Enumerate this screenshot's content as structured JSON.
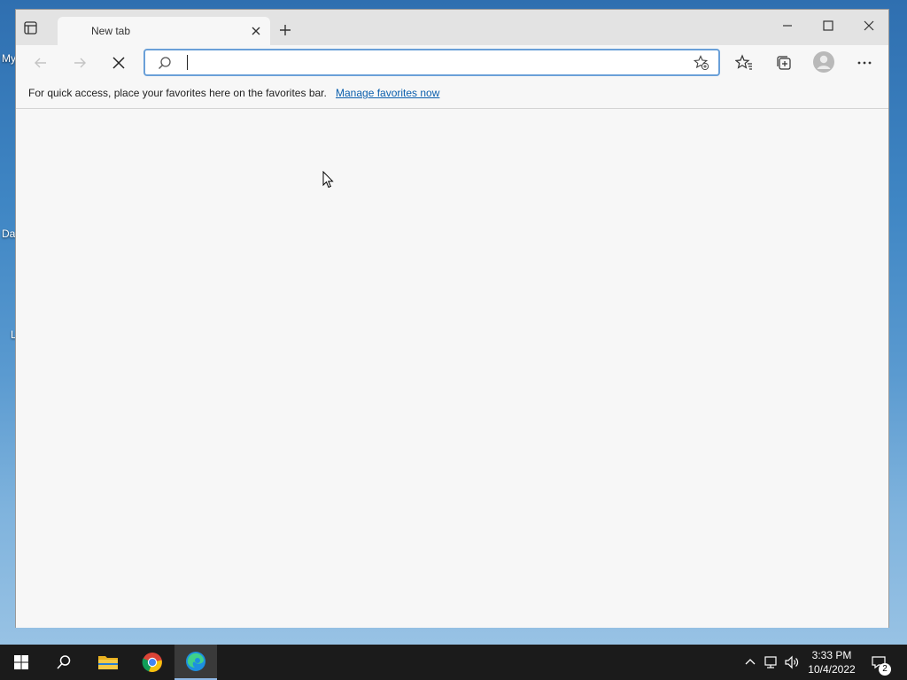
{
  "desktop": {
    "labels": [
      "My",
      "Da",
      "L"
    ]
  },
  "browser": {
    "tab_title": "New tab",
    "address": {
      "value": "",
      "placeholder": ""
    },
    "favorites_bar": {
      "message": "For quick access, place your favorites here on the favorites bar.",
      "link": "Manage favorites now"
    }
  },
  "taskbar": {
    "time": "3:33 PM",
    "date": "10/4/2022",
    "notification_count": "2",
    "apps": [
      "start-icon",
      "search-icon",
      "file-explorer-icon",
      "chrome-icon",
      "edge-icon"
    ]
  },
  "colors": {
    "accent": "#6aa0d8",
    "taskbar": "#1b1b1b",
    "link": "#0b5fad"
  }
}
